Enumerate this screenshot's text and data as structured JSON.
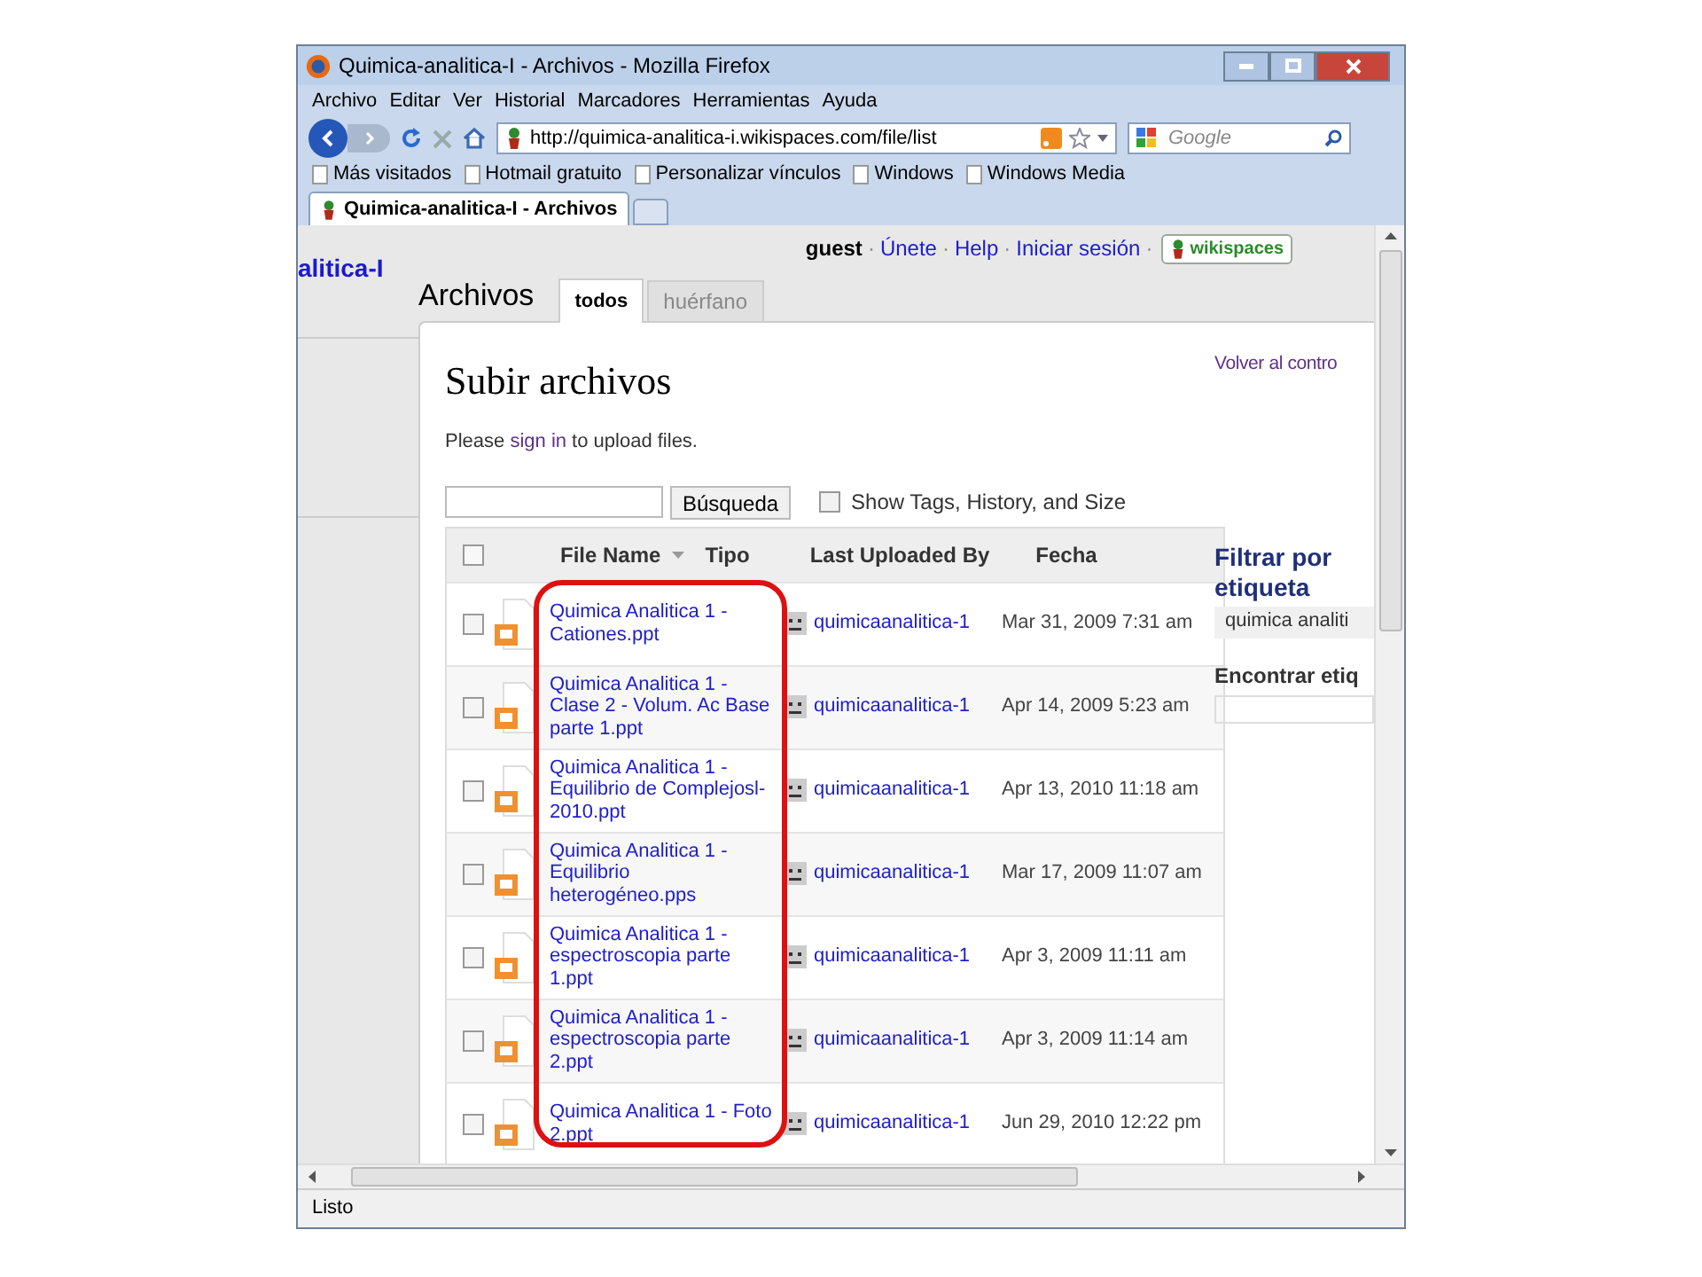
{
  "window": {
    "title": "Quimica-analitica-I - Archivos - Mozilla Firefox"
  },
  "menu": [
    "Archivo",
    "Editar",
    "Ver",
    "Historial",
    "Marcadores",
    "Herramientas",
    "Ayuda"
  ],
  "address": {
    "url": "http://quimica-analitica-i.wikispaces.com/file/list"
  },
  "search": {
    "placeholder": "Google"
  },
  "bookmarks": [
    "Más visitados",
    "Hotmail gratuito",
    "Personalizar vínculos",
    "Windows",
    "Windows Media"
  ],
  "browser_tabs": [
    {
      "label": "Quimica-analitica-I - Archivos",
      "selected": true
    }
  ],
  "site": {
    "name": "alitica-I",
    "user": "guest",
    "links": [
      "Únete",
      "Help",
      "Iniciar sesión"
    ],
    "separator": "·",
    "logo": "wikispaces"
  },
  "page": {
    "title": "Archivos",
    "tabs": [
      {
        "label": "todos",
        "selected": true
      },
      {
        "label": "huérfano",
        "selected": false
      }
    ],
    "back_link": "Volver al contro",
    "heading": "Subir archivos",
    "notice": {
      "before": "Please",
      "link": "sign in",
      "after": "to upload files."
    },
    "search_button": "Búsqueda",
    "show_details": {
      "label": "Show Tags, History, and Size",
      "checked": false
    }
  },
  "table": {
    "select_all": {
      "checked": false
    },
    "columns": [
      "File Name",
      "Tipo",
      "Last Uploaded By",
      "Fecha"
    ],
    "rows": [
      {
        "name": "Quimica Analitica 1 - Cationes.ppt",
        "uploader": "quimicaanalitica-1",
        "date": "Mar 31, 2009 7:31 am",
        "checked": false
      },
      {
        "name": "Quimica Analitica 1 - Clase 2 - Volum. Ac Base parte 1.ppt",
        "uploader": "quimicaanalitica-1",
        "date": "Apr 14, 2009 5:23 am",
        "checked": false
      },
      {
        "name": "Quimica Analitica 1 - Equilibrio de Complejosl-2010.ppt",
        "uploader": "quimicaanalitica-1",
        "date": "Apr 13, 2010 11:18 am",
        "checked": false
      },
      {
        "name": "Quimica Analitica 1 - Equilibrio heterogéneo.pps",
        "uploader": "quimicaanalitica-1",
        "date": "Mar 17, 2009 11:07 am",
        "checked": false
      },
      {
        "name": "Quimica Analitica 1 - espectroscopia parte 1.ppt",
        "uploader": "quimicaanalitica-1",
        "date": "Apr 3, 2009 11:11 am",
        "checked": false
      },
      {
        "name": "Quimica Analitica 1 - espectroscopia parte 2.ppt",
        "uploader": "quimicaanalitica-1",
        "date": "Apr 3, 2009 11:14 am",
        "checked": false
      },
      {
        "name": "Quimica Analitica 1 - Foto 2.ppt",
        "uploader": "quimicaanalitica-1",
        "date": "Jun 29, 2010 12:22 pm",
        "checked": false
      }
    ]
  },
  "sidebar": {
    "filter_title": "Filtrar por etiqueta",
    "filter_value": "quimica analiti",
    "find_label": "Encontrar etiq"
  },
  "status_bar": "Listo"
}
